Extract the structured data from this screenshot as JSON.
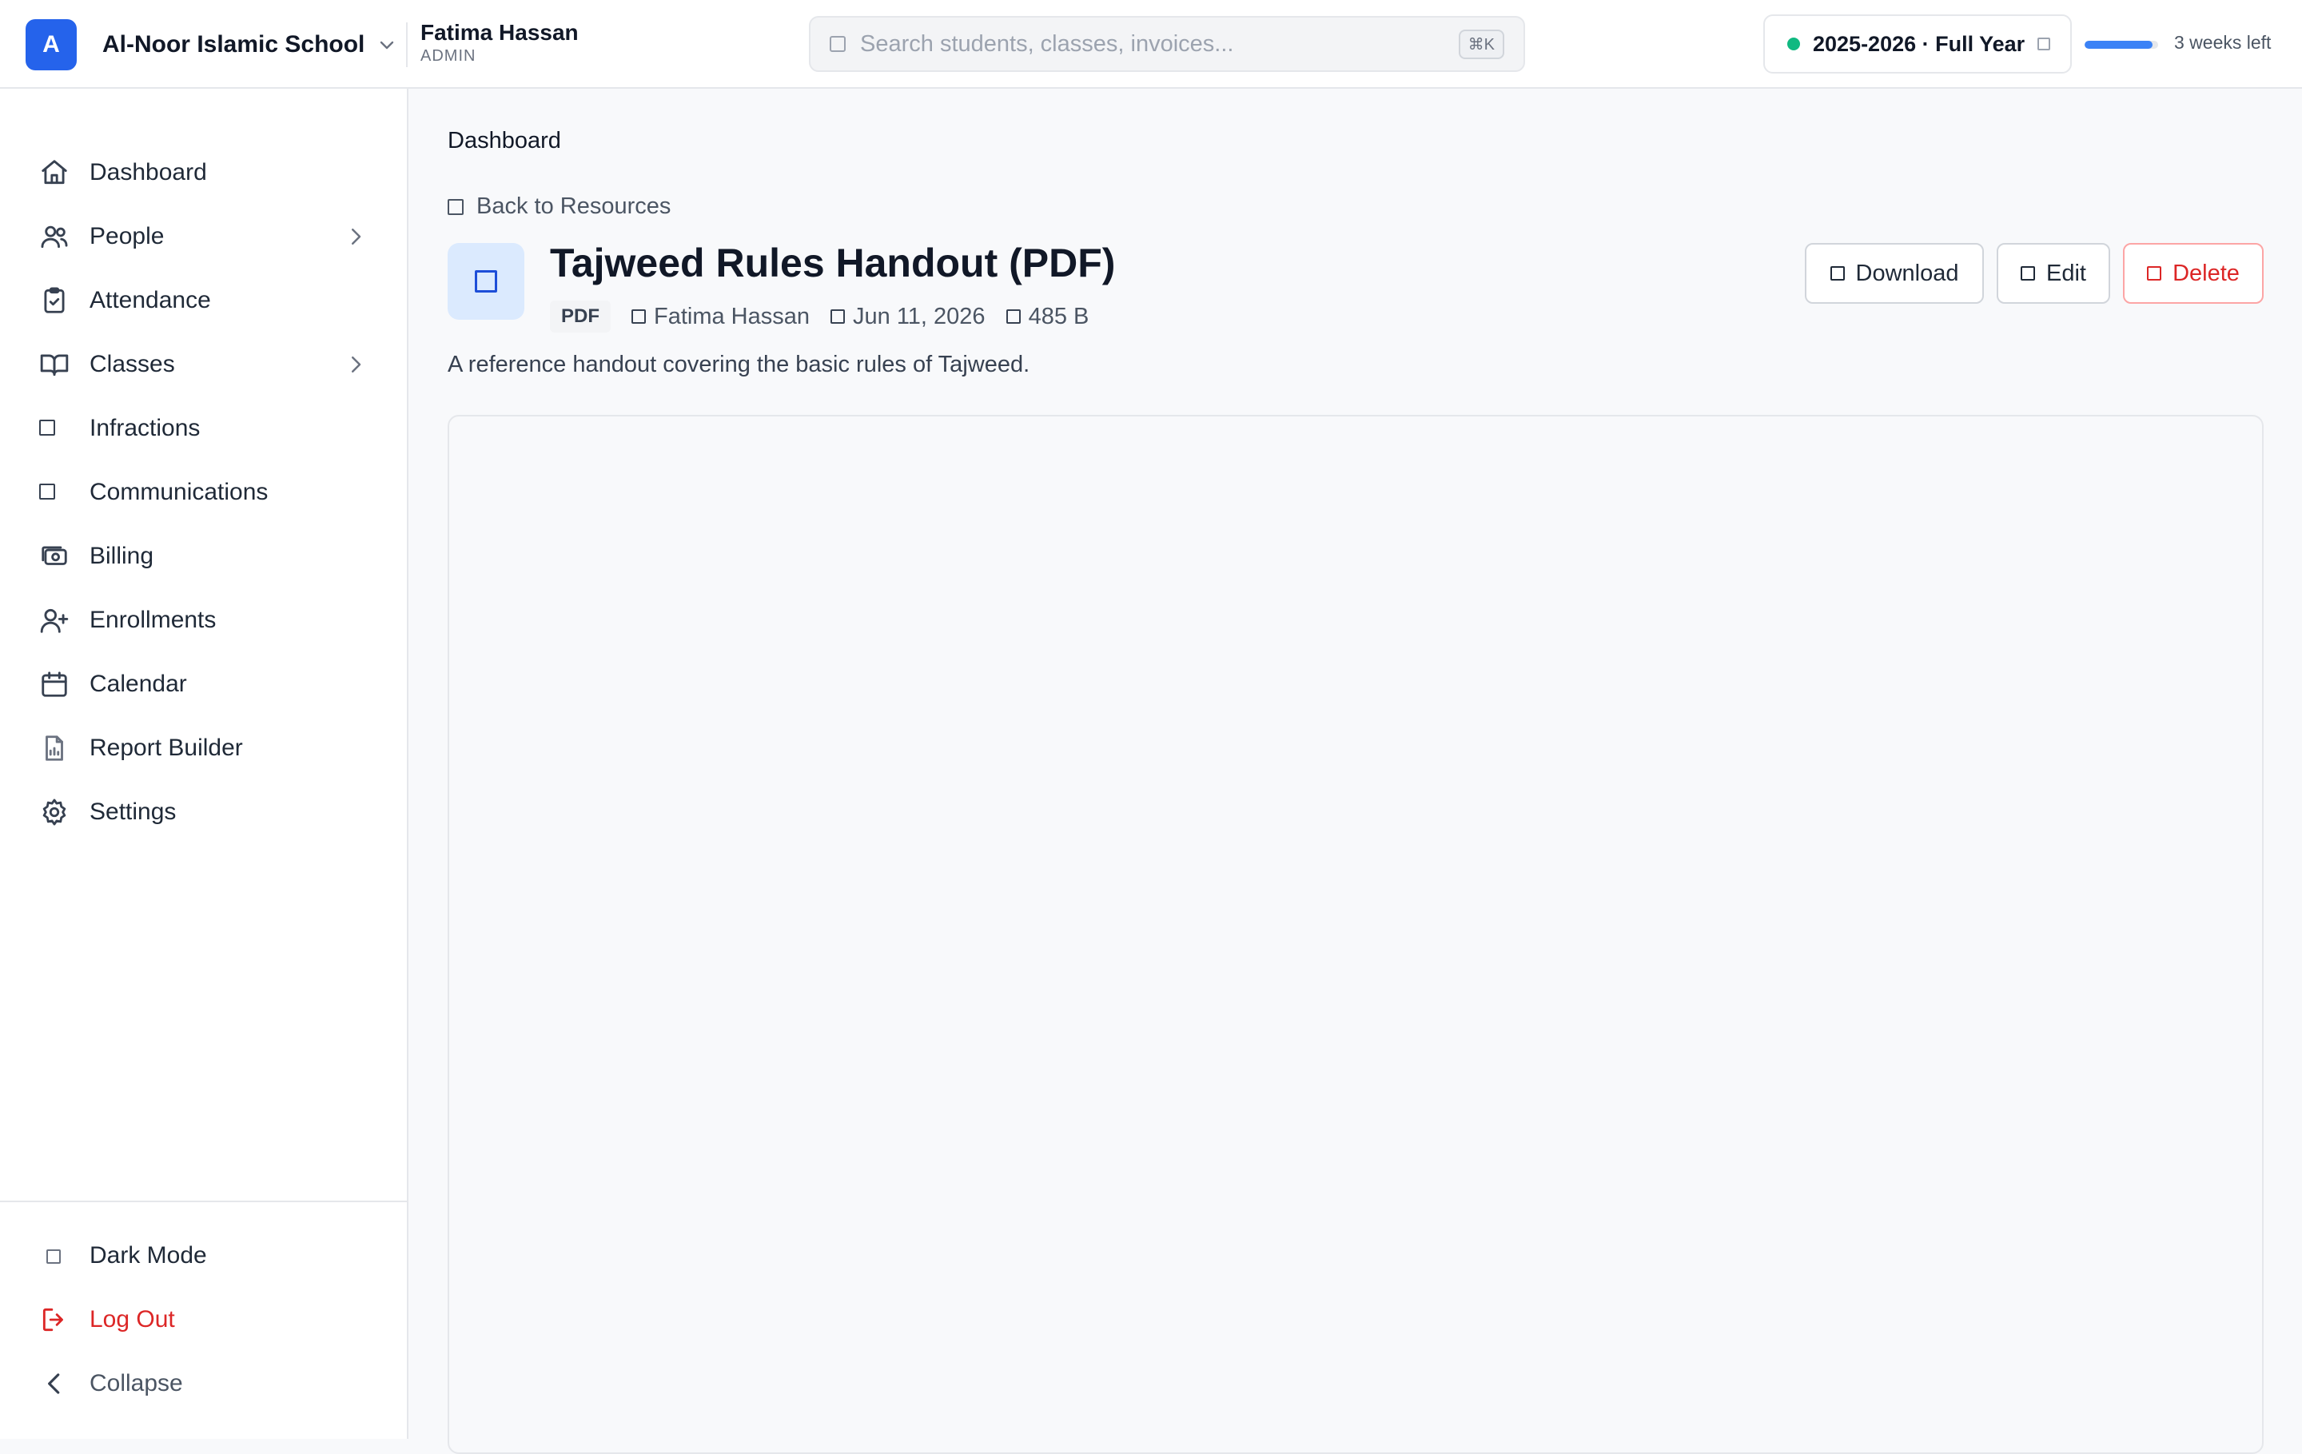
{
  "header": {
    "logo_letter": "A",
    "school_name": "Al-Noor Islamic School",
    "user_name": "Fatima Hassan",
    "user_role": "ADMIN",
    "search_placeholder": "Search students, classes, invoices...",
    "search_shortcut": "⌘K",
    "academic_year": "2025-2026 · Full Year",
    "year_progress_fraction": 0.92,
    "weeks_left": "3 weeks left"
  },
  "sidebar": {
    "items": [
      {
        "label": "Dashboard",
        "icon": "home-icon"
      },
      {
        "label": "People",
        "icon": "users-icon",
        "has_submenu": true
      },
      {
        "label": "Attendance",
        "icon": "clipboard-check-icon"
      },
      {
        "label": "Classes",
        "icon": "book-open-icon",
        "has_submenu": true
      },
      {
        "label": "Infractions",
        "icon": "square-icon"
      },
      {
        "label": "Communications",
        "icon": "square-icon"
      },
      {
        "label": "Billing",
        "icon": "banknote-icon"
      },
      {
        "label": "Enrollments",
        "icon": "user-plus-icon"
      },
      {
        "label": "Calendar",
        "icon": "calendar-icon"
      },
      {
        "label": "Report Builder",
        "icon": "file-chart-icon"
      },
      {
        "label": "Settings",
        "icon": "gear-icon"
      }
    ],
    "footer": {
      "dark_mode": "Dark Mode",
      "logout": "Log Out",
      "collapse": "Collapse"
    }
  },
  "main": {
    "breadcrumb": "Dashboard",
    "back_label": "Back to Resources",
    "title": "Tajweed Rules Handout (PDF)",
    "file_type": "PDF",
    "author": "Fatima Hassan",
    "date": "Jun 11, 2026",
    "size": "485 B",
    "description": "A reference handout covering the basic rules of Tajweed.",
    "actions": {
      "download": "Download",
      "edit": "Edit",
      "delete": "Delete"
    }
  },
  "colors": {
    "accent": "#2563eb",
    "danger": "#dc2626",
    "active_dot": "#10b981"
  }
}
